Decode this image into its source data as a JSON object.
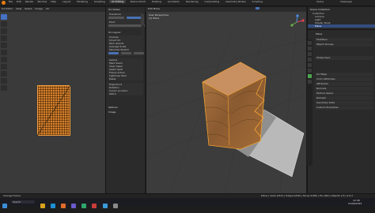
{
  "menubar": {
    "items": [
      "File",
      "Edit",
      "Render",
      "Window",
      "Help"
    ],
    "tabs": [
      "Layout",
      "Modeling",
      "Sculpting",
      "UV Editing",
      "Texture Paint",
      "Shading",
      "Animation",
      "Rendering",
      "Compositing",
      "Geometry Nodes",
      "Scripting"
    ],
    "active_tab": "UV Editing",
    "scene": "Scene",
    "view_layer": "ViewLayer"
  },
  "uv_editor": {
    "mode": "UV Editor",
    "view": "View",
    "select": "Select",
    "image": "Image",
    "uv": "UV"
  },
  "side_panel": {
    "sections": [
      "UV Vertex",
      "UV Layout",
      "Options",
      "Image"
    ],
    "fields": [
      "Transform",
      "Pivot",
      "Snapping",
      "Unwrap",
      "Smart UV",
      "Pack Islands",
      "Average Scale",
      "Minimize Stretch",
      "Seams",
      "Mark Seam",
      "Clear Seam",
      "Select Split",
      "Follow Active",
      "Lightmap Pack",
      "Reset",
      "Edge Pivot",
      "Rotation",
      "Cursor Location",
      "Stitch"
    ]
  },
  "viewport": {
    "mode": "Edit Mode",
    "title": "User Perspective",
    "subtitle": "(1) Plane"
  },
  "properties": {
    "outliner_title": "Scene Collection",
    "outliner_items": [
      "Collection",
      "Camera",
      "Light",
      "Shader Node",
      "Plane"
    ],
    "object_name": "Plane",
    "rows": [
      "Modifiers",
      "Object Groups",
      "Shape Keys",
      "UV Maps",
      "Color Attributes",
      "Attributes",
      "Normals",
      "Texture Space",
      "Remesh",
      "Geometry Data",
      "Custom Properties"
    ]
  },
  "statusbar": {
    "left": "Change Frame",
    "right": "Plane | Verts 0/512 | Edges 0/992 | Faces 0/480 | Tris 960 | Objects 1/3 | 4.0.2"
  },
  "taskbar": {
    "time": "12:38",
    "date": "23/06/2024",
    "search": "Search"
  },
  "colors": {
    "accent": "#4772b3",
    "uv_orange": "#d7822c"
  }
}
